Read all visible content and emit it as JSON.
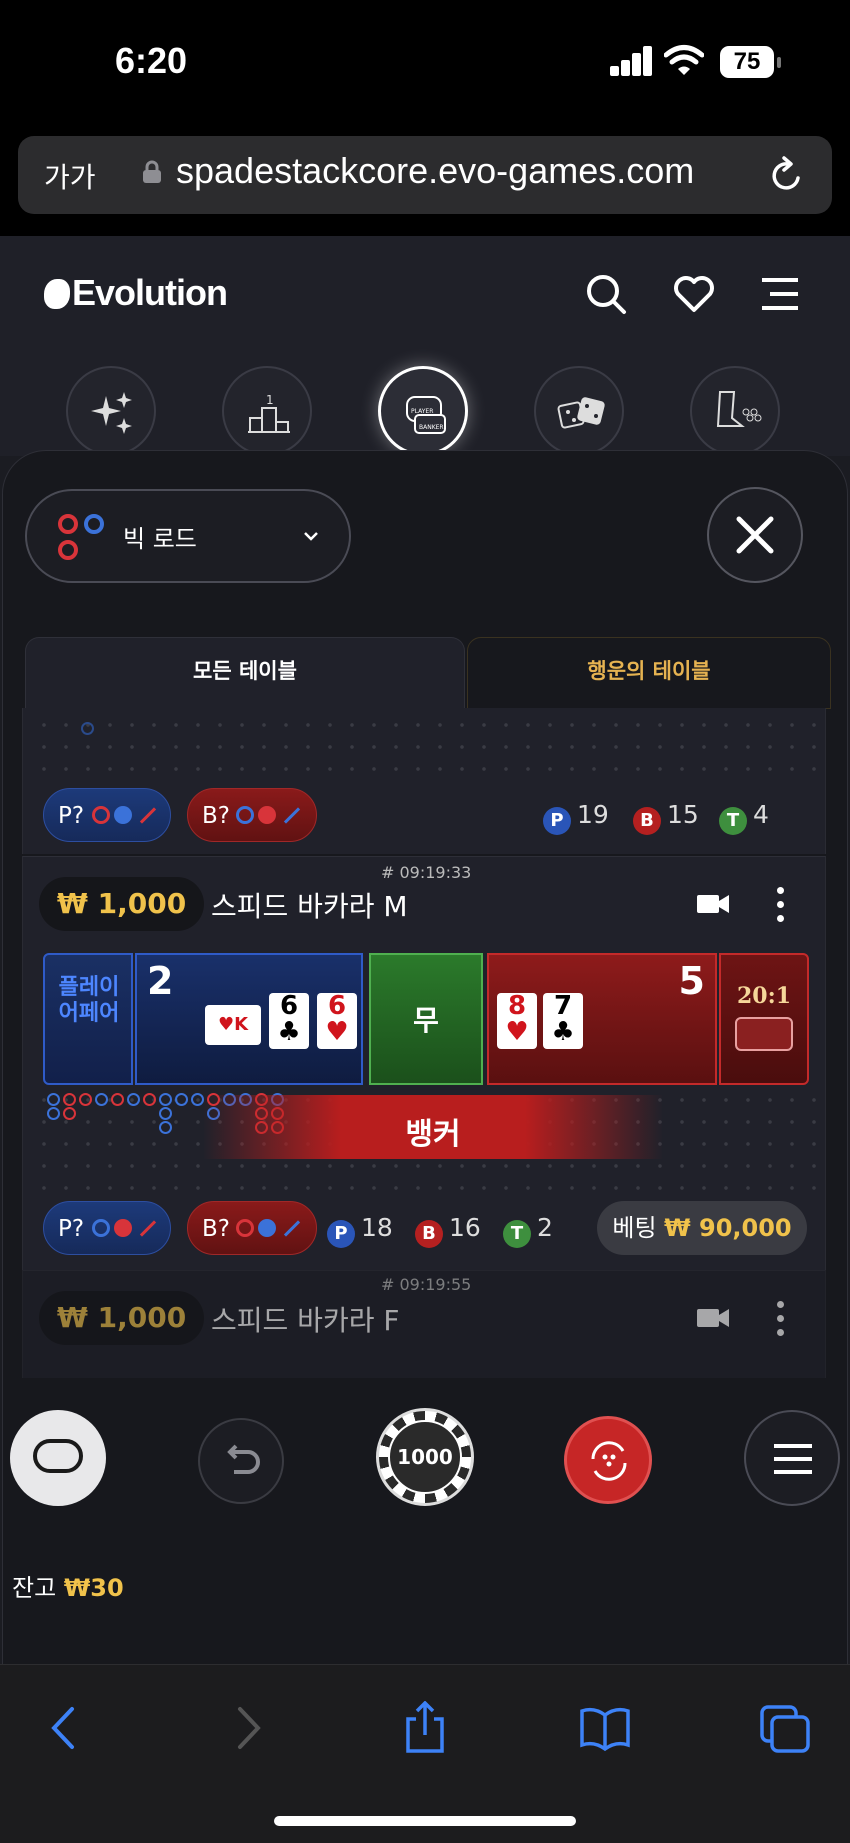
{
  "status_bar": {
    "time": "6:20",
    "battery": "75"
  },
  "browser": {
    "text_size": "가가",
    "url": "spadestackcore.evo-games.com"
  },
  "header": {
    "logo": "Evolution"
  },
  "road_selector": {
    "label": "빅 로드"
  },
  "tabs": [
    {
      "label": "모든 테이블"
    },
    {
      "label": "행운의 테이블"
    }
  ],
  "table_top": {
    "pill_p": "P?",
    "pill_b": "B?",
    "stats": {
      "p": "19",
      "b": "15",
      "t": "4"
    }
  },
  "table_m": {
    "id": "# 09:19:33",
    "min_bet": "₩ 1,000",
    "name": "스피드 바카라 M",
    "player_pair": "플레이어페어",
    "player_score": "2",
    "player_cards": [
      {
        "rank": "K",
        "suit": "♥"
      },
      {
        "rank": "6",
        "suit": "♣"
      },
      {
        "rank": "6",
        "suit": "♥"
      }
    ],
    "tie": "무",
    "banker_score": "5",
    "banker_cards": [
      {
        "rank": "8",
        "suit": "♥"
      },
      {
        "rank": "7",
        "suit": "♣"
      }
    ],
    "side_payout": "20:1",
    "result": "뱅커",
    "pill_p": "P?",
    "pill_b": "B?",
    "stats": {
      "p": "18",
      "b": "16",
      "t": "2"
    },
    "bet_label": "베팅",
    "bet_amount": "₩ 90,000"
  },
  "table_f": {
    "id": "# 09:19:55",
    "min_bet": "₩ 1,000",
    "name": "스피드 바카라 F"
  },
  "controls": {
    "chip": "1000"
  },
  "balance": {
    "label": "잔고",
    "amount": "₩30"
  },
  "colors": {
    "player": "#2a55b8",
    "banker": "#b52020",
    "tie": "#2f8a2f",
    "gold": "#f0c24b"
  }
}
